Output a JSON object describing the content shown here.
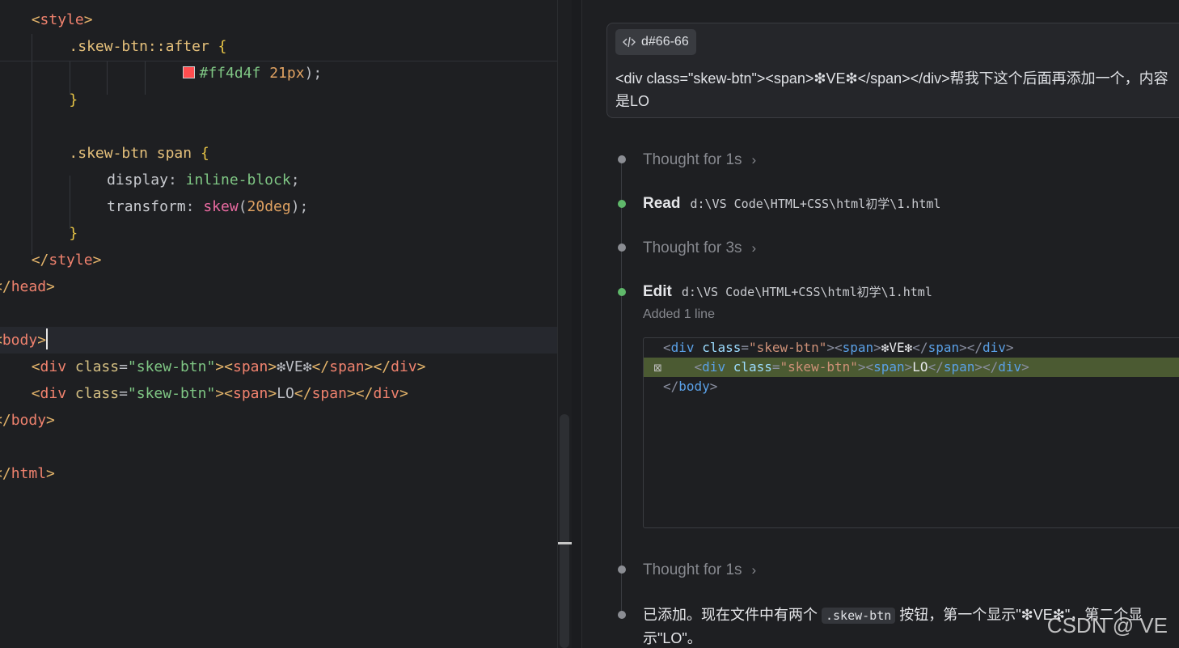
{
  "editor": {
    "lines": [
      {
        "segments": [
          {
            "c": "t-tag",
            "t": "<"
          },
          {
            "c": "t-tagname",
            "t": "style"
          },
          {
            "c": "t-tag",
            "t": ">"
          }
        ],
        "indent": 1
      },
      {
        "segments": [
          {
            "c": "t-sel",
            "t": ".skew-btn::after"
          },
          {
            "c": "t-punc",
            "t": " "
          },
          {
            "c": "t-brace",
            "t": "{"
          }
        ],
        "indent": 2
      },
      {
        "segments": [
          {
            "c": "swatch",
            "t": ""
          },
          {
            "c": "t-val",
            "t": "#ff4d4f"
          },
          {
            "c": "t-punc",
            "t": " "
          },
          {
            "c": "t-num",
            "t": "21px"
          },
          {
            "c": "t-punc",
            "t": ");"
          }
        ],
        "indent": 5
      },
      {
        "segments": [
          {
            "c": "t-brace",
            "t": "}"
          }
        ],
        "indent": 2
      },
      {
        "segments": [],
        "indent": 0
      },
      {
        "segments": [
          {
            "c": "t-sel",
            "t": ".skew-btn span"
          },
          {
            "c": "t-punc",
            "t": " "
          },
          {
            "c": "t-brace",
            "t": "{"
          }
        ],
        "indent": 2
      },
      {
        "segments": [
          {
            "c": "t-prop",
            "t": "display"
          },
          {
            "c": "t-punc",
            "t": ": "
          },
          {
            "c": "t-val",
            "t": "inline-block"
          },
          {
            "c": "t-punc",
            "t": ";"
          }
        ],
        "indent": 3
      },
      {
        "segments": [
          {
            "c": "t-prop",
            "t": "transform"
          },
          {
            "c": "t-punc",
            "t": ": "
          },
          {
            "c": "t-fn",
            "t": "skew"
          },
          {
            "c": "t-punc",
            "t": "("
          },
          {
            "c": "t-num",
            "t": "20deg"
          },
          {
            "c": "t-punc",
            "t": ");"
          }
        ],
        "indent": 3
      },
      {
        "segments": [
          {
            "c": "t-brace",
            "t": "}"
          }
        ],
        "indent": 2
      },
      {
        "segments": [
          {
            "c": "t-tag",
            "t": "</"
          },
          {
            "c": "t-tagname",
            "t": "style"
          },
          {
            "c": "t-tag",
            "t": ">"
          }
        ],
        "indent": 1
      },
      {
        "segments": [
          {
            "c": "t-tag",
            "t": "</"
          },
          {
            "c": "t-tagname",
            "t": "head"
          },
          {
            "c": "t-tag",
            "t": ">"
          }
        ],
        "indent": 0
      },
      {
        "segments": [],
        "indent": 0
      },
      {
        "segments": [
          {
            "c": "t-tag",
            "t": "<"
          },
          {
            "c": "t-tagname",
            "t": "body"
          },
          {
            "c": "t-tag",
            "t": ">"
          },
          {
            "c": "caret",
            "t": ""
          }
        ],
        "indent": 0,
        "current": true
      },
      {
        "segments": [
          {
            "c": "t-tag",
            "t": "<"
          },
          {
            "c": "t-tagname",
            "t": "div"
          },
          {
            "c": "t-punc",
            "t": " "
          },
          {
            "c": "t-attr",
            "t": "class"
          },
          {
            "c": "t-punc",
            "t": "="
          },
          {
            "c": "t-str",
            "t": "\"skew-btn\""
          },
          {
            "c": "t-tag",
            "t": ">"
          },
          {
            "c": "t-tag",
            "t": "<"
          },
          {
            "c": "t-tagname",
            "t": "span"
          },
          {
            "c": "t-tag",
            "t": ">"
          },
          {
            "c": "t-punc",
            "t": "❇VE❇"
          },
          {
            "c": "t-tag",
            "t": "</"
          },
          {
            "c": "t-tagname",
            "t": "span"
          },
          {
            "c": "t-tag",
            "t": ">"
          },
          {
            "c": "t-tag",
            "t": "</"
          },
          {
            "c": "t-tagname",
            "t": "div"
          },
          {
            "c": "t-tag",
            "t": ">"
          }
        ],
        "indent": 1
      },
      {
        "segments": [
          {
            "c": "t-tag",
            "t": "<"
          },
          {
            "c": "t-tagname",
            "t": "div"
          },
          {
            "c": "t-punc",
            "t": " "
          },
          {
            "c": "t-attr",
            "t": "class"
          },
          {
            "c": "t-punc",
            "t": "="
          },
          {
            "c": "t-str",
            "t": "\"skew-btn\""
          },
          {
            "c": "t-tag",
            "t": ">"
          },
          {
            "c": "t-tag",
            "t": "<"
          },
          {
            "c": "t-tagname",
            "t": "span"
          },
          {
            "c": "t-tag",
            "t": ">"
          },
          {
            "c": "t-punc",
            "t": "LO"
          },
          {
            "c": "t-tag",
            "t": "</"
          },
          {
            "c": "t-tagname",
            "t": "span"
          },
          {
            "c": "t-tag",
            "t": ">"
          },
          {
            "c": "t-tag",
            "t": "</"
          },
          {
            "c": "t-tagname",
            "t": "div"
          },
          {
            "c": "t-tag",
            "t": ">"
          }
        ],
        "indent": 1
      },
      {
        "segments": [
          {
            "c": "t-tag",
            "t": "</"
          },
          {
            "c": "t-tagname",
            "t": "body"
          },
          {
            "c": "t-tag",
            "t": ">"
          }
        ],
        "indent": 0
      },
      {
        "segments": [],
        "indent": 0
      },
      {
        "segments": [
          {
            "c": "t-tag",
            "t": "</"
          },
          {
            "c": "t-tagname",
            "t": "html"
          },
          {
            "c": "t-tag",
            "t": ">"
          }
        ],
        "indent": 0
      }
    ]
  },
  "chat": {
    "context_chip": "d#66-66",
    "prompt": "<div class=\"skew-btn\"><span>❇VE❇</span></div>帮我下这个后面再添加一个，内容是LO",
    "steps": {
      "thought1": "Thought for 1s",
      "read_title": "Read",
      "read_path": "d:\\VS Code\\HTML+CSS\\html初学\\1.html",
      "thought2": "Thought for 3s",
      "edit_title": "Edit",
      "edit_path": "d:\\VS Code\\HTML+CSS\\html初学\\1.html",
      "edit_sub": "Added 1 line",
      "thought3": "Thought for 1s"
    },
    "diff_lines": [
      {
        "added": false,
        "segments": [
          {
            "c": "d-punc",
            "t": "<"
          },
          {
            "c": "d-tag",
            "t": "div"
          },
          {
            "c": "d-punc",
            "t": " "
          },
          {
            "c": "d-attr",
            "t": "class"
          },
          {
            "c": "d-punc",
            "t": "="
          },
          {
            "c": "d-str",
            "t": "\"skew-btn\""
          },
          {
            "c": "d-punc",
            "t": "><"
          },
          {
            "c": "d-tag",
            "t": "span"
          },
          {
            "c": "d-punc",
            "t": ">"
          },
          {
            "c": "d-text",
            "t": "❇VE❇"
          },
          {
            "c": "d-punc",
            "t": "</"
          },
          {
            "c": "d-tag",
            "t": "span"
          },
          {
            "c": "d-punc",
            "t": "></"
          },
          {
            "c": "d-tag",
            "t": "div"
          },
          {
            "c": "d-punc",
            "t": ">"
          }
        ]
      },
      {
        "added": true,
        "segments": [
          {
            "c": "d-punc",
            "t": "    <"
          },
          {
            "c": "d-tag",
            "t": "div"
          },
          {
            "c": "d-punc",
            "t": " "
          },
          {
            "c": "d-attr",
            "t": "class"
          },
          {
            "c": "d-punc",
            "t": "="
          },
          {
            "c": "d-str",
            "t": "\"skew-btn\""
          },
          {
            "c": "d-punc",
            "t": "><"
          },
          {
            "c": "d-tag",
            "t": "span"
          },
          {
            "c": "d-punc",
            "t": ">"
          },
          {
            "c": "d-text",
            "t": "LO"
          },
          {
            "c": "d-punc",
            "t": "</"
          },
          {
            "c": "d-tag",
            "t": "span"
          },
          {
            "c": "d-punc",
            "t": "></"
          },
          {
            "c": "d-tag",
            "t": "div"
          },
          {
            "c": "d-punc",
            "t": ">"
          }
        ]
      },
      {
        "added": false,
        "segments": [
          {
            "c": "d-punc",
            "t": "</"
          },
          {
            "c": "d-tag",
            "t": "body"
          },
          {
            "c": "d-punc",
            "t": ">"
          }
        ]
      }
    ],
    "final_before": "已添加。现在文件中有两个 ",
    "final_code": ".skew-btn",
    "final_after": " 按钮，第一个显示\"❇VE❇\"，第二个显示\"LO\"。"
  },
  "watermark": "CSDN @ VE",
  "colors": {
    "accent_green": "#5fb86a",
    "swatch": "#ff4d4f"
  }
}
